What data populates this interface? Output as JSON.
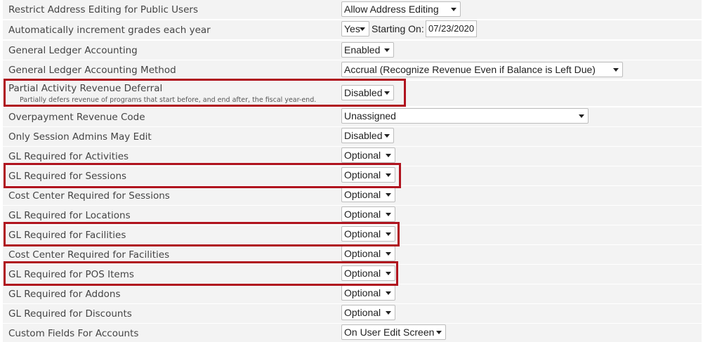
{
  "settings": [
    {
      "label": "Restrict Address Editing for Public Users",
      "value": "Allow Address Editing"
    },
    {
      "label": "Automatically increment grades each year",
      "value": "Yes",
      "starting_on_label": "Starting On:",
      "starting_on_value": "07/23/2020"
    },
    {
      "label": "General Ledger Accounting",
      "value": "Enabled"
    },
    {
      "label": "General Ledger Accounting Method",
      "value": "Accrual (Recognize Revenue Even if Balance is Left Due)"
    },
    {
      "label": "Partial Activity Revenue Deferral",
      "sublabel": "Partially defers revenue of programs that start before, and end after, the fiscal year-end.",
      "value": "Disabled"
    },
    {
      "label": "Overpayment Revenue Code",
      "value": "Unassigned"
    },
    {
      "label": "Only Session Admins May Edit",
      "value": "Disabled"
    },
    {
      "label": "GL Required for Activities",
      "value": "Optional"
    },
    {
      "label": "GL Required for Sessions",
      "value": "Optional"
    },
    {
      "label": "Cost Center Required for Sessions",
      "value": "Optional"
    },
    {
      "label": "GL Required for Locations",
      "value": "Optional"
    },
    {
      "label": "GL Required for Facilities",
      "value": "Optional"
    },
    {
      "label": "Cost Center Required for Facilities",
      "value": "Optional"
    },
    {
      "label": "GL Required for POS Items",
      "value": "Optional"
    },
    {
      "label": "GL Required for Addons",
      "value": "Optional"
    },
    {
      "label": "GL Required for Discounts",
      "value": "Optional"
    },
    {
      "label": "Custom Fields For Accounts",
      "value": "On User Edit Screen"
    }
  ],
  "colors": {
    "highlight": "#b0131e",
    "row_background": "#f3f3f3"
  },
  "icons": {
    "dropdown": "caret-down-icon"
  }
}
